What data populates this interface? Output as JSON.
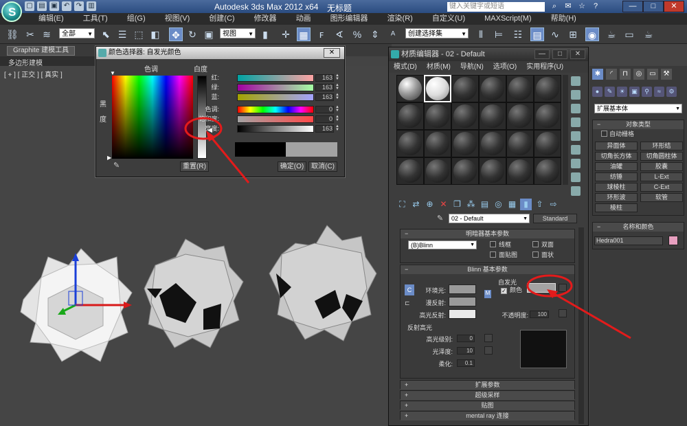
{
  "titlebar": {
    "app_title": "Autodesk 3ds Max  2012 x64",
    "document": "无标题",
    "search_placeholder": "键入关键字或短语",
    "buttons": {
      "minimize": "—",
      "maximize": "□",
      "close": "✕"
    }
  },
  "menubar": [
    "编辑(E)",
    "工具(T)",
    "组(G)",
    "视图(V)",
    "创建(C)",
    "修改器",
    "动画",
    "图形编辑器",
    "渲染(R)",
    "自定义(U)",
    "MAXScript(M)",
    "帮助(H)"
  ],
  "toolbar": {
    "filter_select": "全部",
    "view_select": "视图",
    "named_selection": "创建选择集"
  },
  "ribbon": {
    "tab": "Graphite 建模工具",
    "sub": "多边形建模"
  },
  "viewport": {
    "label": "[ + ] [ 正交 ] [ 真实 ]"
  },
  "color_picker": {
    "title": "颜色选择器: 自发光颜色",
    "hue_label": "色调",
    "whiteness_label": "白度",
    "blackness_label": "黑度",
    "rows": [
      {
        "label": "红:",
        "value": "163"
      },
      {
        "label": "绿:",
        "value": "163"
      },
      {
        "label": "蓝:",
        "value": "163"
      },
      {
        "label": "色调:",
        "value": "0"
      },
      {
        "label": "饱和度:",
        "value": "0"
      },
      {
        "label": "亮度:",
        "value": "163"
      }
    ],
    "reset_btn": "重置(R)",
    "ok_btn": "确定(O)",
    "cancel_btn": "取消(C)",
    "old_color": "#000000",
    "new_color": "#a3a3a3"
  },
  "material_editor": {
    "title": "材质编辑器 - 02 - Default",
    "menus": [
      "模式(D)",
      "材质(M)",
      "导航(N)",
      "选项(O)",
      "实用程序(U)"
    ],
    "material_name": "02 - Default",
    "material_type": "Standard",
    "shader_rollout": {
      "title": "明暗器基本参数",
      "shader": "(B)Blinn",
      "checks": [
        "线框",
        "双面",
        "面贴图",
        "面状"
      ]
    },
    "blinn_rollout": {
      "title": "Blinn 基本参数",
      "self_illum_group": "自发光",
      "color_check": "颜色",
      "ambient": "环境光:",
      "diffuse": "漫反射:",
      "specular": "高光反射:",
      "opacity_label": "不透明度:",
      "opacity_value": "100",
      "spec_group": "反射高光",
      "spec_level_label": "高光级别:",
      "spec_level": "0",
      "gloss_label": "光泽度:",
      "gloss": "10",
      "soften_label": "柔化:",
      "soften": "0.1",
      "self_illum_color": "#a3a3a3"
    },
    "collapsed_rollouts": [
      "扩展参数",
      "超级采样",
      "贴图",
      "mental ray 连接"
    ]
  },
  "command_panel": {
    "dropdown": "扩展基本体",
    "object_type_title": "对象类型",
    "autogrid": "自动栅格",
    "objects": [
      "异面体",
      "环形结",
      "切角长方体",
      "切角圆柱体",
      "油罐",
      "胶囊",
      "纺锤",
      "L-Ext",
      "球棱柱",
      "C-Ext",
      "环形波",
      "软管",
      "棱柱"
    ],
    "name_color_title": "名称和颜色",
    "object_name": "Hedra001",
    "object_color": "#e79fbf"
  }
}
